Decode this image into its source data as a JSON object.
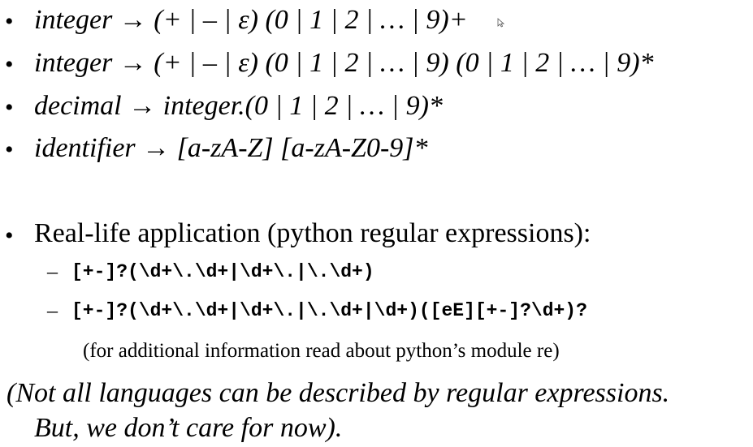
{
  "rules": [
    {
      "bullet": "•",
      "text": "integer → (+ | – | ε) (0 | 1 | 2 | … | 9)+"
    },
    {
      "bullet": "•",
      "text": "integer → (+ | – | ε) (0 | 1 | 2 | … | 9) (0 | 1 | 2 | … | 9)*"
    },
    {
      "bullet": "•",
      "text": "decimal → integer.(0 | 1 | 2 | … | 9)*"
    },
    {
      "bullet": "•",
      "text": "identifier → [a-zA-Z] [a-zA-Z0-9]*"
    }
  ],
  "application": {
    "bullet": "•",
    "heading": "Real-life application (python regular expressions):",
    "patterns": [
      {
        "dash": "–",
        "code": "[+-]?(\\d+\\.\\d+|\\d+\\.|\\.\\d+)"
      },
      {
        "dash": "–",
        "code": "[+-]?(\\d+\\.\\d+|\\d+\\.|\\.\\d+|\\d+)([eE][+-]?\\d+)?"
      }
    ],
    "note": "(for additional information read about python’s module re)"
  },
  "closing": {
    "line1": "(Not all languages can be described by regular expressions.",
    "line2": "But, we don’t care for now)."
  }
}
